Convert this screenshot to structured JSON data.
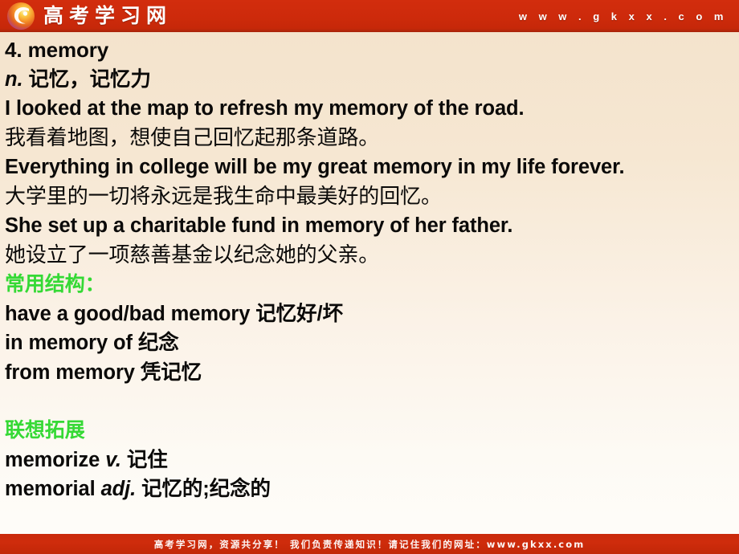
{
  "header": {
    "logo_icon": "circular-gradient-logo-icon",
    "site_name": "高考学习网",
    "url": "w w w . g k x x . c o m"
  },
  "slide": {
    "entry_number": "4.",
    "word": "memory",
    "lines": [
      {
        "id": "title",
        "kind": "head",
        "text": "4. memory"
      },
      {
        "id": "pos-def",
        "kind": "mixed",
        "pos": "n.",
        "text": "n. 记忆，记忆力"
      },
      {
        "id": "example1-en",
        "kind": "en",
        "text": "I looked at the map to refresh my memory of the road."
      },
      {
        "id": "example1-cn",
        "kind": "cn",
        "text": "我看着地图，想使自己回忆起那条道路。"
      },
      {
        "id": "example2-en",
        "kind": "en",
        "text": "Everything in college will be my great memory in my life forever."
      },
      {
        "id": "example2-cn",
        "kind": "cn",
        "text": "大学里的一切将永远是我生命中最美好的回忆。"
      },
      {
        "id": "example3-en",
        "kind": "en",
        "text": "She set up a charitable fund in memory of her father."
      },
      {
        "id": "example3-cn",
        "kind": "cn",
        "text": "她设立了一项慈善基金以纪念她的父亲。"
      },
      {
        "id": "structures-heading",
        "kind": "green",
        "text": "常用结构："
      },
      {
        "id": "structure1",
        "kind": "mixed",
        "text": "have a good/bad memory 记忆好/坏"
      },
      {
        "id": "structure2",
        "kind": "mixed",
        "text": "in memory of 纪念"
      },
      {
        "id": "structure3",
        "kind": "mixed",
        "text": "from memory 凭记忆"
      },
      {
        "id": "blank",
        "kind": "spacer",
        "text": ""
      },
      {
        "id": "extension-heading",
        "kind": "green",
        "text": "联想拓展"
      },
      {
        "id": "extension1",
        "kind": "mixed",
        "text": "memorize v. 记住"
      },
      {
        "id": "extension2",
        "kind": "mixed",
        "text": "memorial adj. 记忆的;纪念的"
      }
    ]
  },
  "footer": {
    "text": "高考学习网，资源共分享！ 我们负责传递知识！请记住我们的网址：www.gkxx.com"
  },
  "colors": {
    "header_red": "#cd2a0b",
    "footer_red": "#c9290b",
    "green_heading": "#35d935",
    "body_text": "#0b0a09",
    "background_top": "#f3e2cb",
    "background_bottom": "#fefdfa"
  }
}
